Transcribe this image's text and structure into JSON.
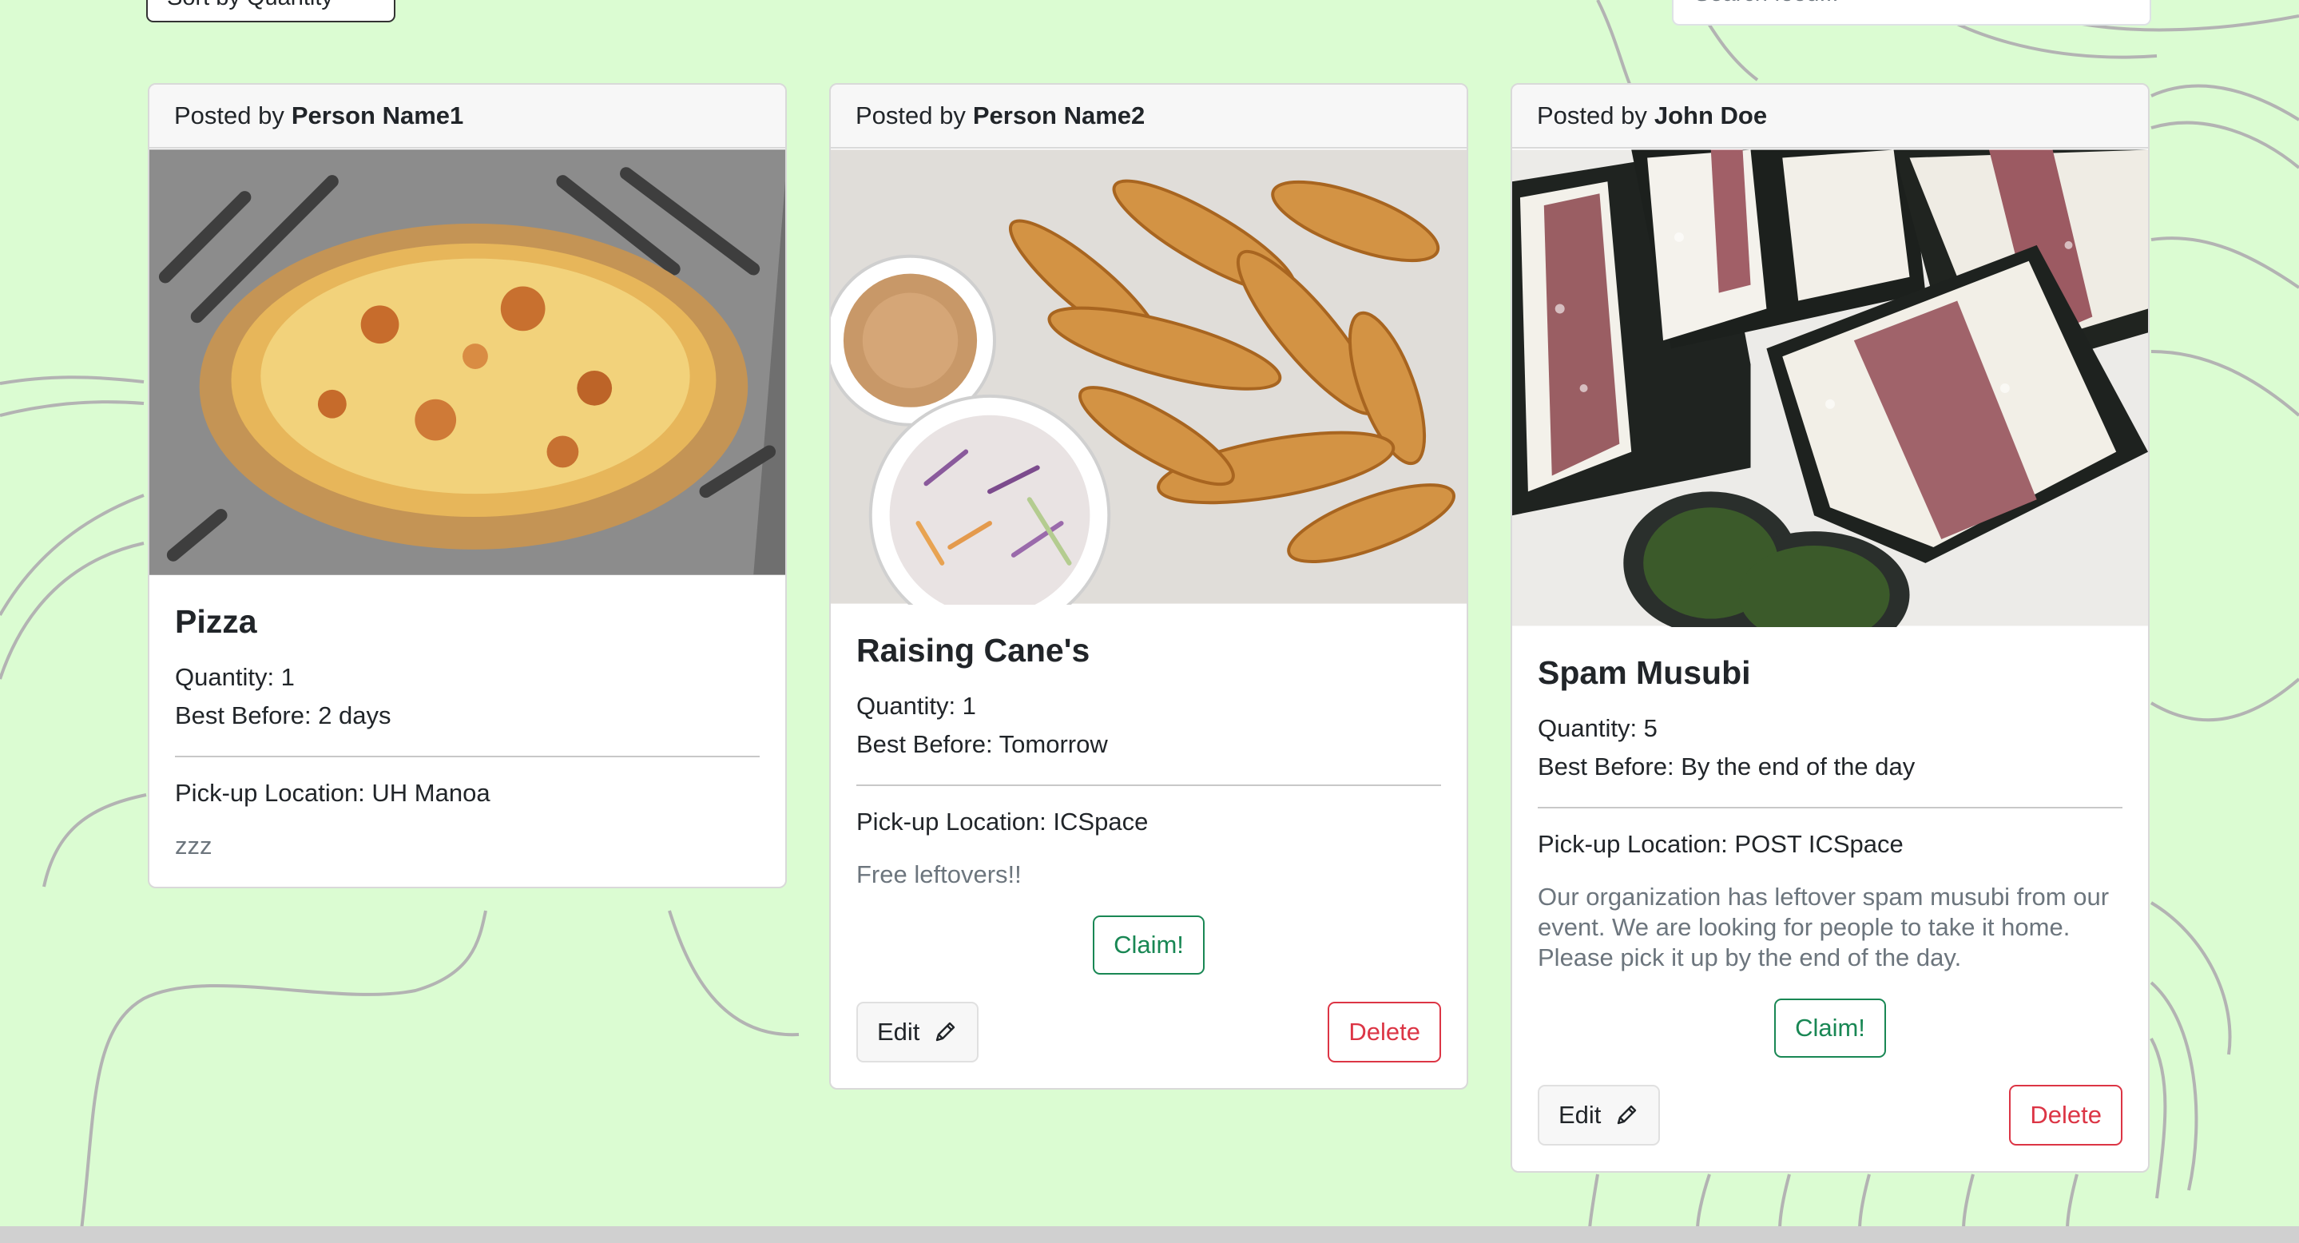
{
  "controls": {
    "sort_label": "Sort by Quantity",
    "search_placeholder": "Search food..."
  },
  "cards": [
    {
      "posted_by_prefix": "Posted by",
      "author": "Person Name1",
      "title": "Pizza",
      "quantity": "Quantity: 1",
      "best_before": "Best Before: 2 days",
      "location": "Pick-up Location: UH Manoa",
      "description": "zzz"
    },
    {
      "posted_by_prefix": "Posted by",
      "author": "Person Name2",
      "title": "Raising Cane's",
      "quantity": "Quantity: 1",
      "best_before": "Best Before: Tomorrow",
      "location": "Pick-up Location: ICSpace",
      "description": "Free leftovers!!",
      "claim_label": "Claim!",
      "edit_label": "Edit",
      "delete_label": "Delete"
    },
    {
      "posted_by_prefix": "Posted by",
      "author": "John Doe",
      "title": "Spam Musubi",
      "quantity": "Quantity: 5",
      "best_before": "Best Before: By the end of the day",
      "location": "Pick-up Location: POST ICSpace",
      "description": "Our organization has leftover spam musubi from our event. We are looking for people to take it home. Please pick it up by the end of the day.",
      "claim_label": "Claim!",
      "edit_label": "Edit",
      "delete_label": "Delete"
    }
  ],
  "icons": {
    "edit": "pencil-icon"
  },
  "colors": {
    "background": "#dbfcd2",
    "claim": "#198754",
    "delete": "#dc3545"
  }
}
